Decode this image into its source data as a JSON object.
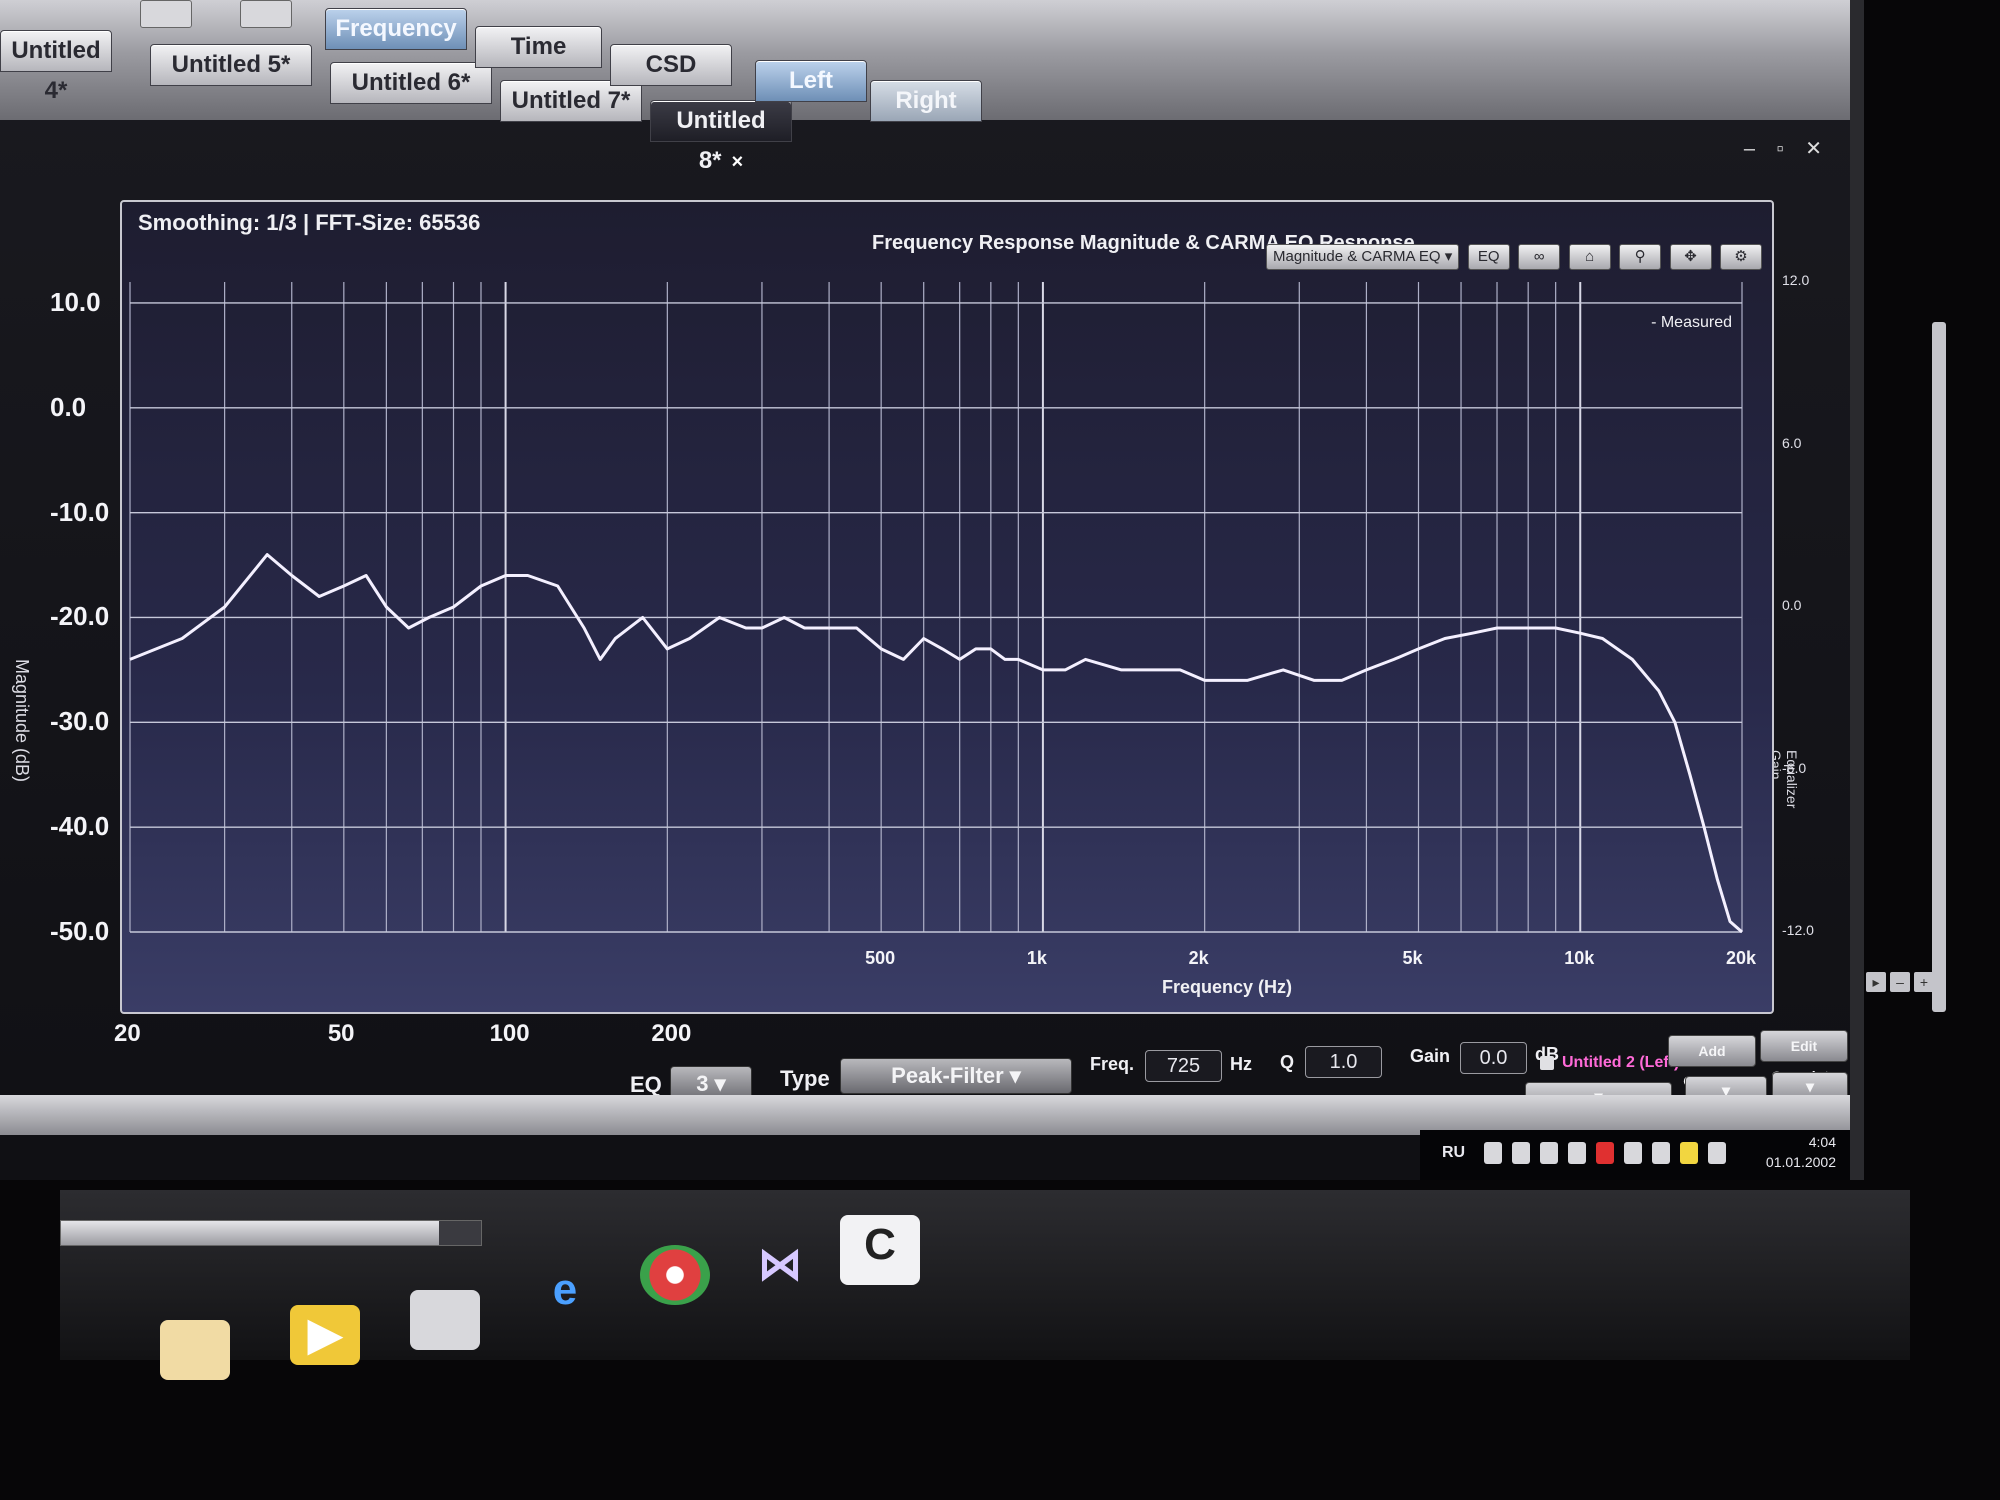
{
  "tabs_top": [
    {
      "label": "Untitled 4*"
    },
    {
      "label": "Untitled 5*"
    },
    {
      "label": "Untitled 6*"
    },
    {
      "label": "Untitled 7*"
    },
    {
      "label": "Untitled 8*",
      "close": "×"
    }
  ],
  "view_tabs": [
    "Frequency",
    "Time",
    "CSD"
  ],
  "channel_tabs": [
    "Left",
    "Right"
  ],
  "window_controls": "– ▫ ✕",
  "plot": {
    "smoothing": "Smoothing: 1/3 | FFT-Size: 65536",
    "title": "Frequency Response Magnitude & CARMA EQ Response",
    "view_select": "Magnitude & CARMA EQ",
    "eq_button": "EQ",
    "link_button": "∞",
    "legend": "- Measured",
    "y_left_title": "Magnitude (dB)",
    "y_right_title": "Equalizer Gain (dB)",
    "x_title": "Frequency (Hz)"
  },
  "chart_data": {
    "type": "line",
    "title": "Frequency Response Magnitude & CARMA EQ Response",
    "xlabel": "Frequency (Hz)",
    "ylabel": "",
    "y2label": "Equalizer Gain (dB)",
    "xscale": "log",
    "xlim": [
      20,
      20000
    ],
    "ylim": [
      -50,
      12
    ],
    "y2lim": [
      -12,
      12
    ],
    "grid": true,
    "legend": "top-right",
    "x_ticks": [
      "20",
      "50",
      "100",
      "200",
      "500",
      "1k",
      "2k",
      "5k",
      "10k",
      "20k"
    ],
    "y_ticks": [
      "10.0",
      "0.0",
      "-10.0",
      "-20.0",
      "-30.0",
      "-40.0",
      "-50.0"
    ],
    "y2_ticks": [
      "12.0",
      "6.0",
      "0.0",
      "-6.0",
      "-12.0"
    ],
    "series": [
      {
        "name": "Measured",
        "color": "#f4f0ff",
        "x": [
          20,
          25,
          30,
          36,
          40,
          45,
          50,
          55,
          60,
          66,
          72,
          80,
          90,
          100,
          110,
          125,
          140,
          150,
          160,
          180,
          200,
          220,
          250,
          280,
          300,
          330,
          360,
          400,
          450,
          500,
          550,
          600,
          650,
          700,
          750,
          800,
          850,
          900,
          1000,
          1100,
          1200,
          1400,
          1600,
          1800,
          2000,
          2400,
          2800,
          3200,
          3600,
          4000,
          4500,
          5000,
          5600,
          6300,
          7000,
          8000,
          9000,
          10000,
          11000,
          12500,
          14000,
          15000,
          16000,
          17000,
          18000,
          19000,
          20000
        ],
        "values": [
          -24,
          -22,
          -19,
          -14,
          -16,
          -18,
          -17,
          -16,
          -19,
          -21,
          -20,
          -19,
          -17,
          -16,
          -16,
          -17,
          -21,
          -24,
          -22,
          -20,
          -23,
          -22,
          -20,
          -21,
          -21,
          -20,
          -21,
          -21,
          -21,
          -23,
          -24,
          -22,
          -23,
          -24,
          -23,
          -23,
          -24,
          -24,
          -25,
          -25,
          -24,
          -25,
          -25,
          -25,
          -26,
          -26,
          -25,
          -26,
          -26,
          -25,
          -24,
          -23,
          -22,
          -21.5,
          -21,
          -21,
          -21,
          -21.5,
          -22,
          -24,
          -27,
          -30,
          -35,
          -40,
          -45,
          -49,
          -50
        ]
      }
    ]
  },
  "eq": {
    "eq_label": "EQ",
    "eq_value": "3",
    "type_label": "Type",
    "type_value": "Peak-Filter",
    "freq_label": "Freq.",
    "freq_value": "725",
    "freq_unit": "Hz",
    "q_label": "Q",
    "q_value": "1.0",
    "gain_label": "Gain",
    "gain_value": "0.0",
    "gain_unit": "dB",
    "overlay_name": "Untitled 2 (Left)",
    "add_overplot": "Add Overplot",
    "edit_overplots": "Edit Overplots"
  },
  "tray": {
    "lang": "RU",
    "time": "4:04",
    "date": "01.01.2002"
  },
  "taskbar": {
    "progress": 0.9,
    "items": [
      "folder-icon",
      "video-player-icon",
      "apple-icon",
      "internet-explorer-icon",
      "chrome-icon",
      "bowtie-app-icon",
      "carma-app-icon"
    ]
  }
}
